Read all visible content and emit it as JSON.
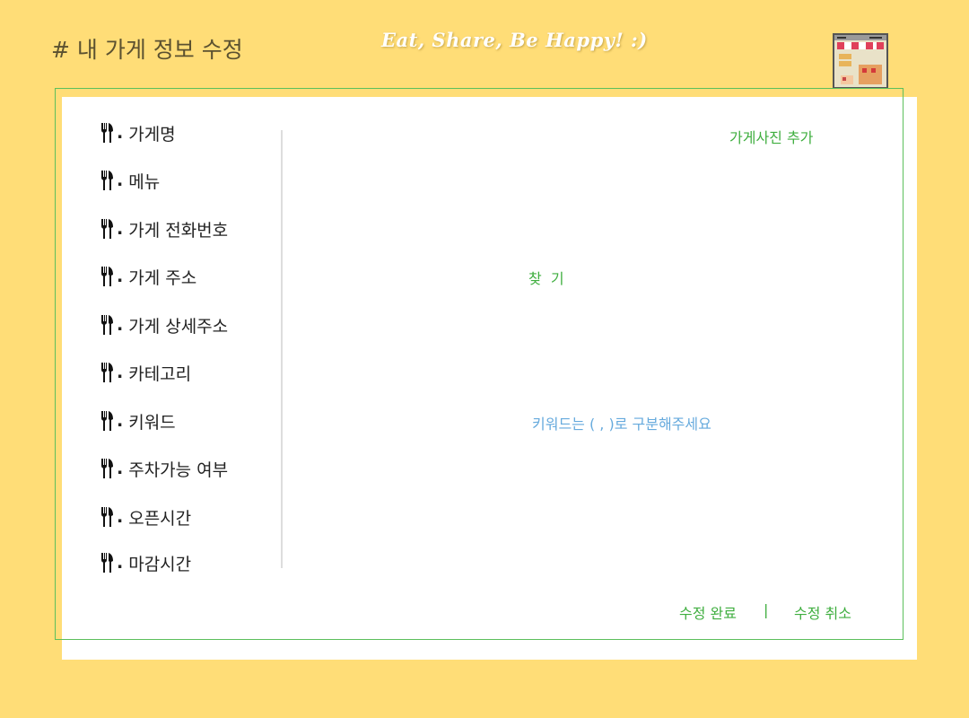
{
  "header": {
    "title": "# 내 가게 정보 수정",
    "slogan": "Eat, Share, Be Happy! :)"
  },
  "icons": {
    "list_bullet": "fork-knife-icon",
    "corner": "store-icon"
  },
  "fields": [
    {
      "label": "가게명"
    },
    {
      "label": "메뉴"
    },
    {
      "label": "가게 전화번호"
    },
    {
      "label": "가게 주소"
    },
    {
      "label": "가게 상세주소"
    },
    {
      "label": "카테고리"
    },
    {
      "label": "키워드"
    },
    {
      "label": "주차가능 여부"
    },
    {
      "label": "오픈시간"
    },
    {
      "label": "마감시간"
    }
  ],
  "bullet_suffix": ".",
  "actions": {
    "add_photo": "가게사진 추가",
    "find_address": "찾  기",
    "keyword_hint": "키워드는 ( , )로 구분해주세요",
    "save": "수정 완료",
    "separator": "|",
    "cancel": "수정 취소"
  },
  "colors": {
    "background": "#ffdd77",
    "accent_green": "#3fae3f",
    "hint_blue": "#66aadd",
    "card": "#ffffff"
  }
}
